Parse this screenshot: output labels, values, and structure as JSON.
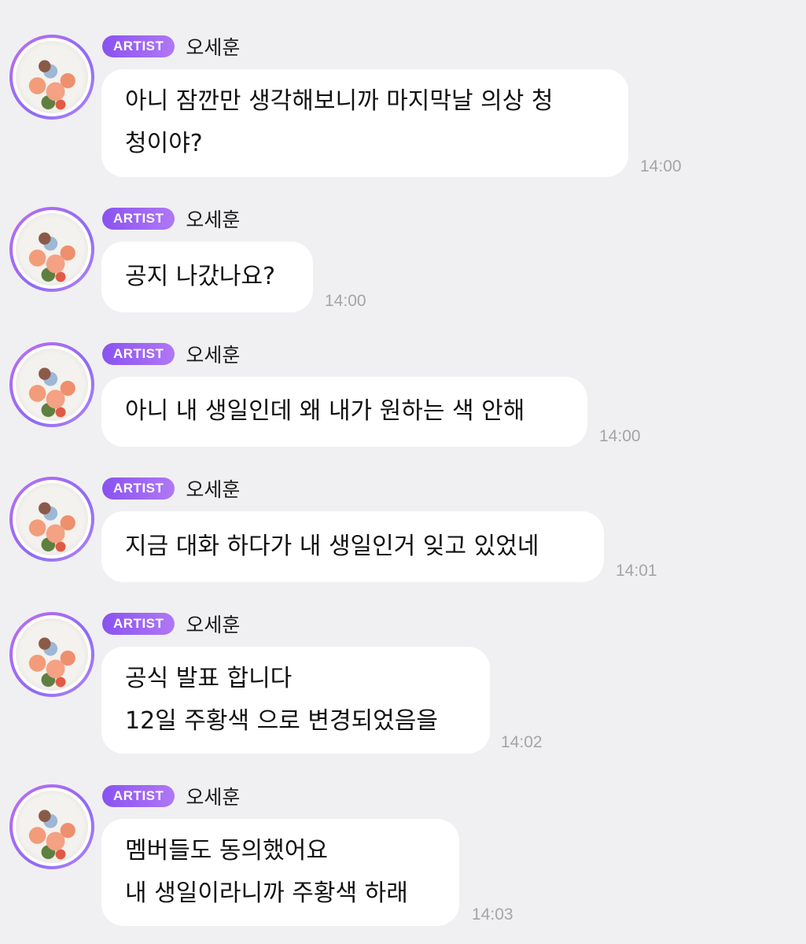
{
  "messages": [
    {
      "badge": "ARTIST",
      "sender": "오세훈",
      "lines": [
        "아니 잠깐만 생각해보니까  마지막날 의상 청",
        "청이야?"
      ],
      "time": "14:00"
    },
    {
      "badge": "ARTIST",
      "sender": "오세훈",
      "lines": [
        "공지 나갔나요?"
      ],
      "time": "14:00"
    },
    {
      "badge": "ARTIST",
      "sender": "오세훈",
      "lines": [
        "아니 내 생일인데 왜 내가 원하는 색 안해"
      ],
      "time": "14:00"
    },
    {
      "badge": "ARTIST",
      "sender": "오세훈",
      "lines": [
        "지금 대화 하다가 내 생일인거 잊고 있었네"
      ],
      "time": "14:01"
    },
    {
      "badge": "ARTIST",
      "sender": "오세훈",
      "lines": [
        "공식 발표 합니다",
        "12일 주황색 으로 변경되었음을"
      ],
      "time": "14:02"
    },
    {
      "badge": "ARTIST",
      "sender": "오세훈",
      "lines": [
        "멤버들도 동의했어요",
        "내 생일이라니까 주황색 하래"
      ],
      "time": "14:03"
    }
  ],
  "colors": {
    "background": "#f0f0f2",
    "bubble": "#ffffff",
    "badge_start": "#8a52f0",
    "badge_end": "#b078f5",
    "time": "#a5a5a8"
  }
}
